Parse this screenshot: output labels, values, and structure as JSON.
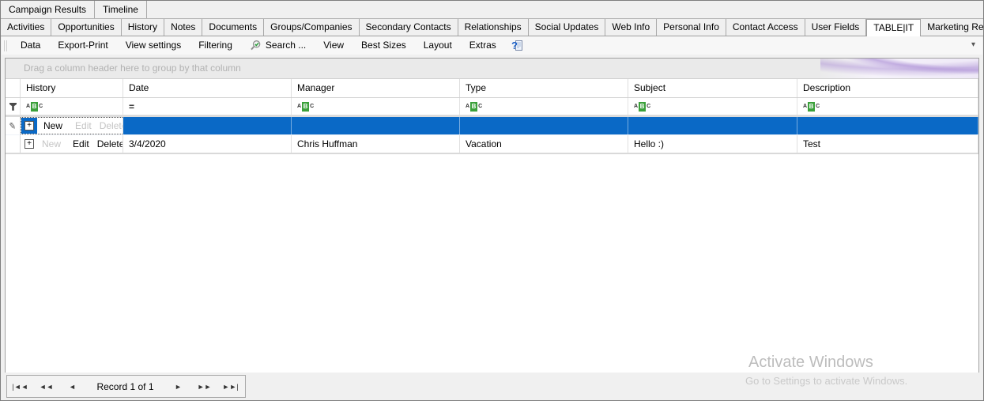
{
  "tabs": {
    "top": [
      "Campaign Results",
      "Timeline"
    ],
    "contact": [
      "Activities",
      "Opportunities",
      "History",
      "Notes",
      "Documents",
      "Groups/Companies",
      "Secondary Contacts",
      "Relationships",
      "Social Updates",
      "Web Info",
      "Personal Info",
      "Contact Access",
      "User Fields",
      "TABLE|IT",
      "Marketing Results"
    ],
    "active": "TABLE|IT"
  },
  "toolbar": {
    "items": [
      "Data",
      "Export-Print",
      "View settings",
      "Filtering",
      "Search ...",
      "View",
      "Best Sizes",
      "Layout",
      "Extras"
    ]
  },
  "grid": {
    "group_panel": "Drag a column header here to group by that column",
    "columns": [
      "History",
      "Date",
      "Manager",
      "Type",
      "Subject",
      "Description"
    ],
    "filter_row": {
      "text_operator_letters": [
        "A",
        "B",
        "C"
      ],
      "date_operator": "="
    },
    "actions": {
      "new": "New",
      "edit": "Edit",
      "delete": "Delete"
    },
    "rows": [
      {
        "date": "3/4/2020",
        "manager": "Chris Huffman",
        "type": "Vacation",
        "subject": "Hello :)",
        "description": "Test"
      }
    ]
  },
  "glyphs": {
    "expand": "+",
    "pencil": "✎",
    "overflow": "▾"
  },
  "record_navigator": {
    "first": "|◄◄",
    "fast_prev": "◄◄",
    "prev": "◄",
    "label": "Record 1 of 1",
    "next": "►",
    "fast_next": "►►",
    "last": "►►|"
  },
  "watermark": {
    "title": "Activate Windows",
    "subtitle": "Go to Settings to activate Windows."
  },
  "colors": {
    "selection_blue": "#0a69c6",
    "filter_green": "#3ba03b",
    "swoosh_purple": "#b79edb"
  }
}
